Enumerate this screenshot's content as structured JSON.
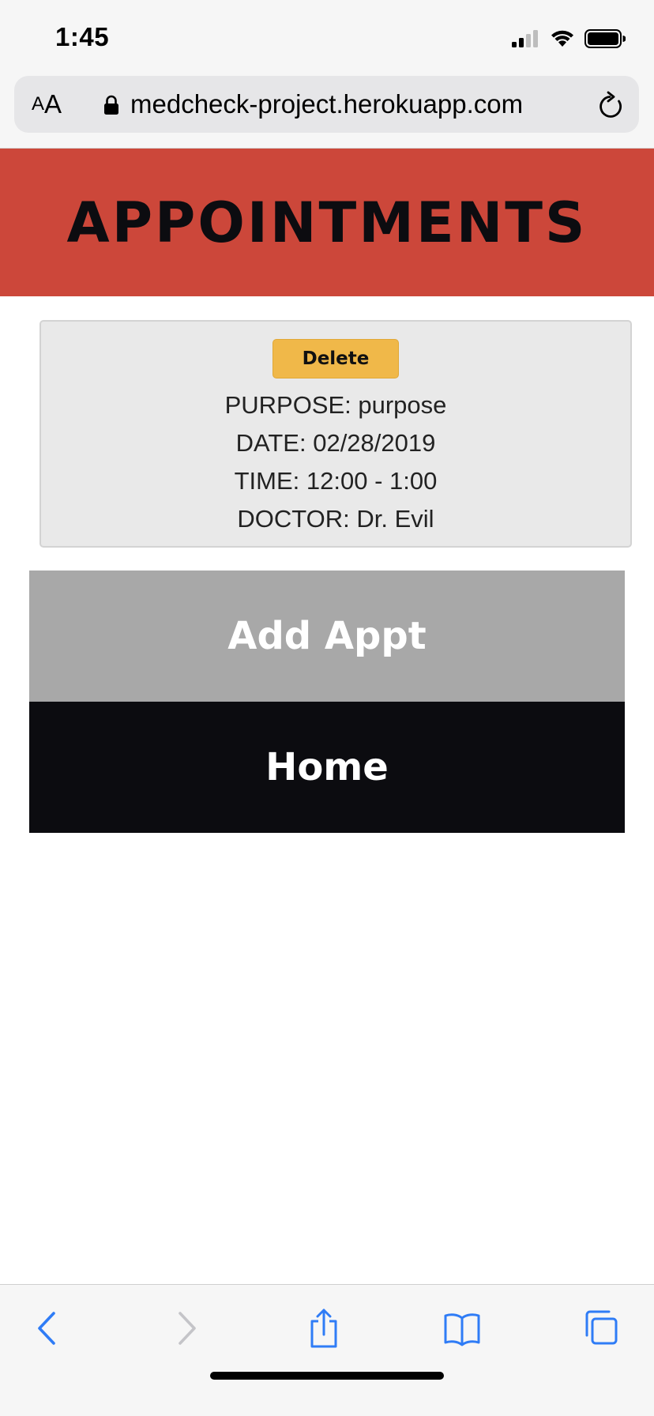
{
  "status_bar": {
    "time": "1:45"
  },
  "browser": {
    "text_size_small": "A",
    "text_size_large": "A",
    "url": "medcheck-project.herokuapp.com"
  },
  "page": {
    "title": "APPOINTMENTS",
    "appointment": {
      "delete_label": "Delete",
      "purpose": "PURPOSE: purpose",
      "date": "DATE: 02/28/2019",
      "time": "TIME: 12:00 - 1:00",
      "doctor": "DOCTOR: Dr. Evil"
    },
    "add_appt_label": "Add Appt",
    "home_label": "Home"
  },
  "colors": {
    "header_bg": "#cc473a",
    "delete_bg": "#f0b849",
    "add_appt_bg": "#a8a8a8",
    "home_bg": "#0c0c10",
    "card_bg": "#e9e9e9",
    "ios_blue": "#2f7cf6"
  },
  "icons": {
    "status": [
      "cellular-signal-icon",
      "wifi-icon",
      "battery-icon"
    ],
    "browser": [
      "lock-icon",
      "reload-icon"
    ],
    "toolbar": [
      "back-icon",
      "forward-icon",
      "share-icon",
      "bookmarks-icon",
      "tabs-icon"
    ]
  }
}
